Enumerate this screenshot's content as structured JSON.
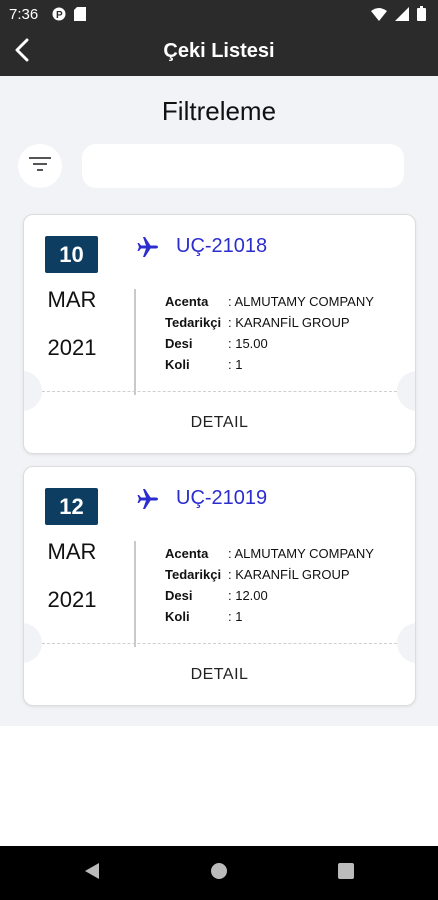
{
  "status_bar": {
    "time": "7:36",
    "icons": [
      "p-badge-icon",
      "sim-card-icon",
      "wifi-icon",
      "signal-icon",
      "battery-icon"
    ]
  },
  "header": {
    "title": "Çeki Listesi",
    "back_icon": "back-arrow-icon"
  },
  "filter": {
    "title": "Filtreleme",
    "search_value": "",
    "search_placeholder": "",
    "filter_icon": "filter-icon"
  },
  "cards": [
    {
      "day": "10",
      "month": "MAR",
      "year": "2021",
      "code": "UÇ-21018",
      "fields": [
        {
          "label": "Acenta",
          "value": ": ALMUTAMY COMPANY"
        },
        {
          "label": "Tedarikçi",
          "value": ": KARANFİL GROUP"
        },
        {
          "label": "Desi",
          "value": ": 15.00"
        },
        {
          "label": "Koli",
          "value": ": 1"
        }
      ],
      "detail_label": "DETAIL"
    },
    {
      "day": "12",
      "month": "MAR",
      "year": "2021",
      "code": "UÇ-21019",
      "fields": [
        {
          "label": "Acenta",
          "value": ": ALMUTAMY COMPANY"
        },
        {
          "label": "Tedarikçi",
          "value": ": KARANFİL GROUP"
        },
        {
          "label": "Desi",
          "value": ": 12.00"
        },
        {
          "label": "Koli",
          "value": ": 1"
        }
      ],
      "detail_label": "DETAIL"
    }
  ],
  "colors": {
    "app_bar": "#2b2b2b",
    "date_badge": "#0d3e61",
    "code_text": "#2c2dcf",
    "background": "#f1f3f6"
  }
}
